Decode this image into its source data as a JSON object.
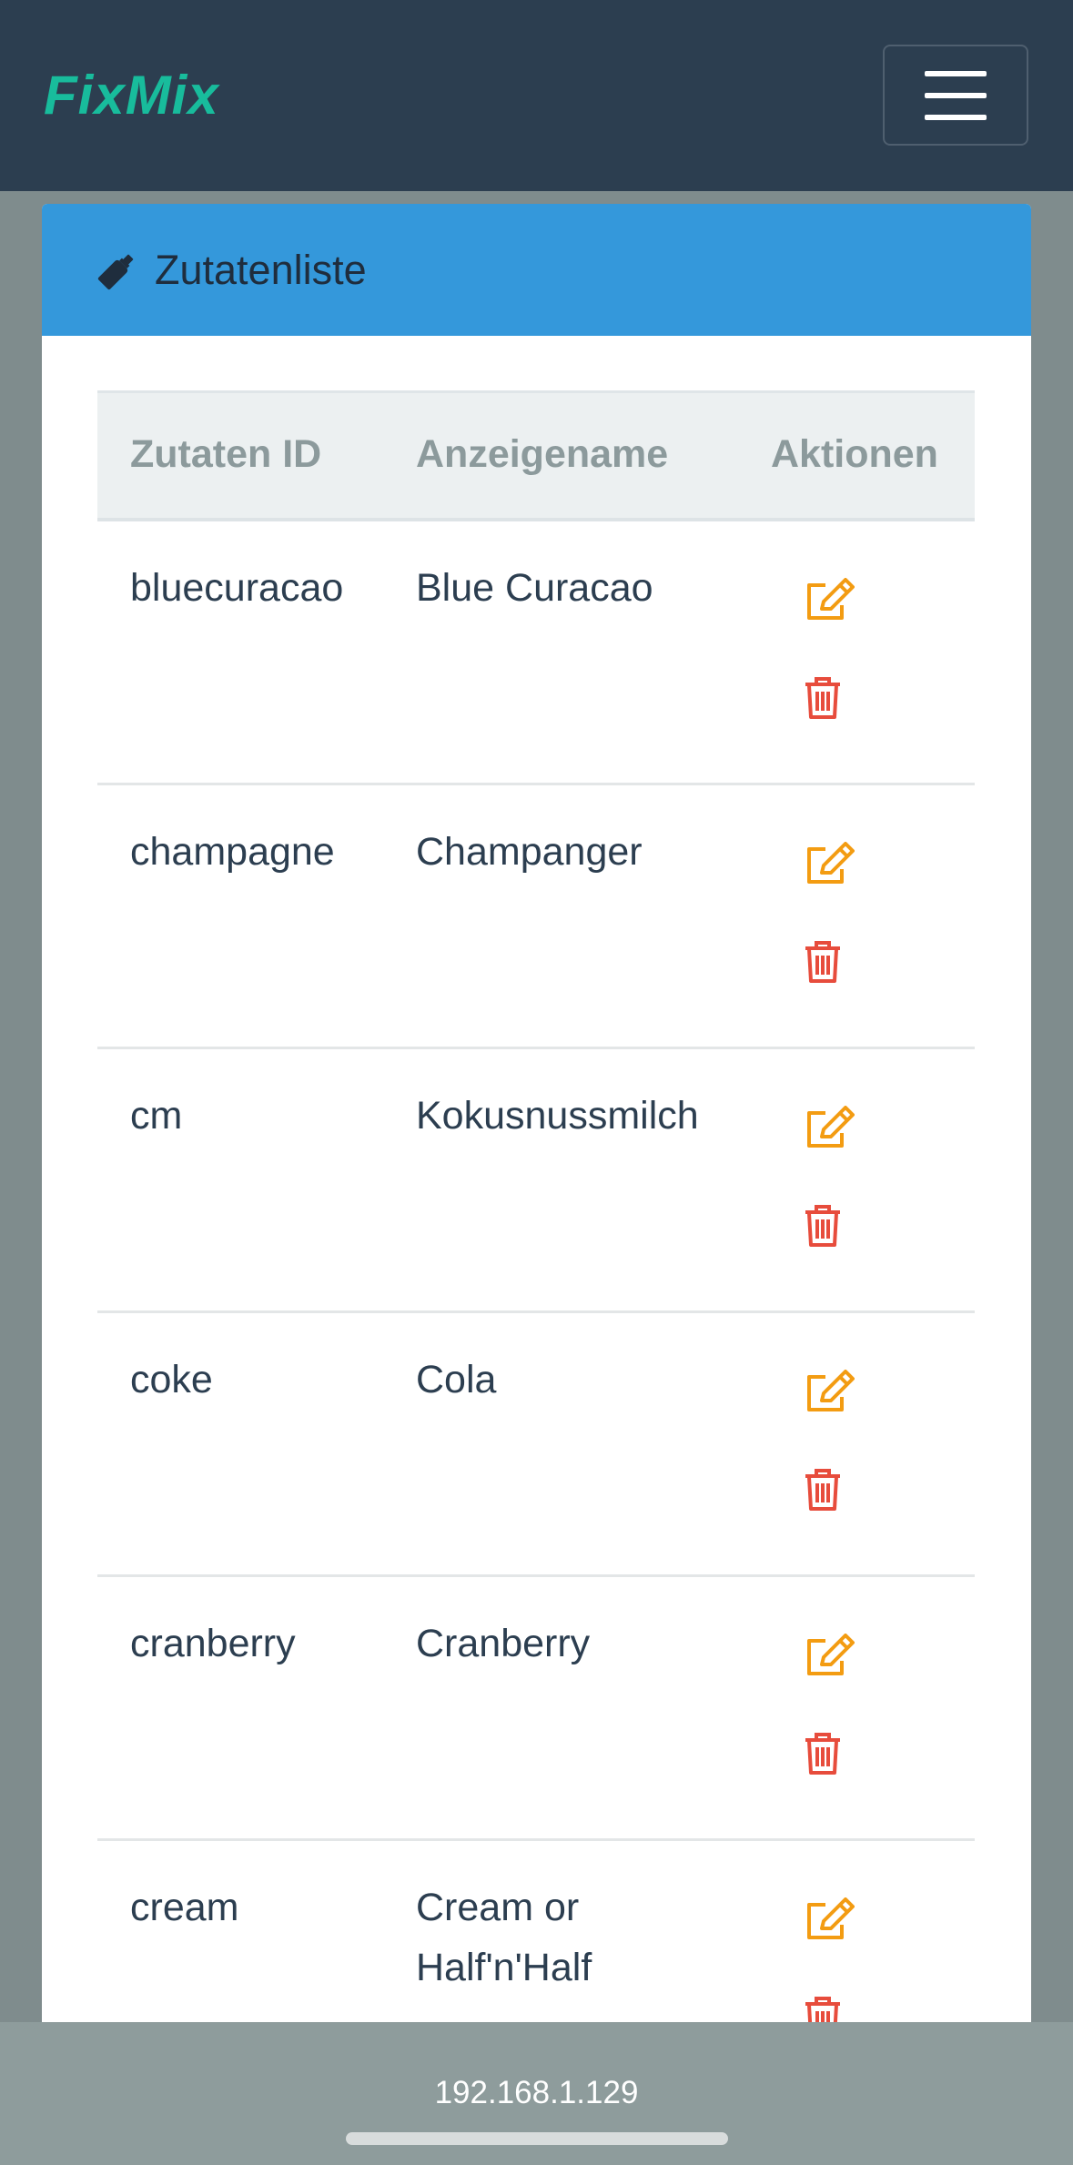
{
  "navbar": {
    "brand": "FixMix",
    "menu_icon": "hamburger-menu-icon"
  },
  "card": {
    "title": "Zutatenliste",
    "title_icon": "bottle-icon"
  },
  "table": {
    "headers": [
      "Zutaten ID",
      "Anzeigename",
      "Aktionen"
    ],
    "rows": [
      {
        "id": "bluecuracao",
        "name": "Blue Curacao"
      },
      {
        "id": "champagne",
        "name": "Champanger"
      },
      {
        "id": "cm",
        "name": "Kokusnussmilch"
      },
      {
        "id": "coke",
        "name": "Cola"
      },
      {
        "id": "cranberry",
        "name": "Cranberry"
      },
      {
        "id": "cream",
        "name": "Cream or Half'n'Half"
      }
    ],
    "action_icons": {
      "edit": "edit-icon",
      "delete": "trash-icon"
    }
  },
  "browser": {
    "url": "192.168.1.129"
  },
  "colors": {
    "navbar": "#2c3e50",
    "brand": "#18bc9c",
    "card_header": "#3498db",
    "edit": "#f39c12",
    "delete": "#e74c3c",
    "page_bg": "#7f8c8d"
  }
}
